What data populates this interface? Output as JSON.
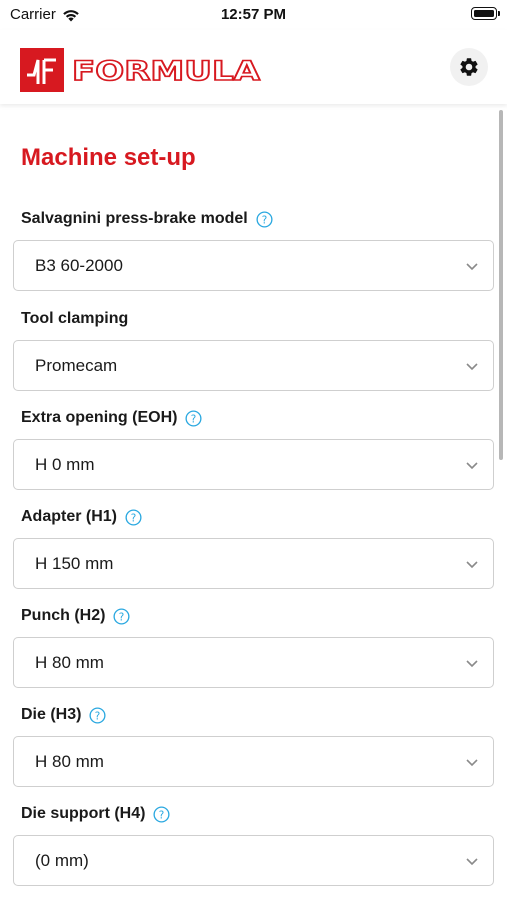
{
  "status_bar": {
    "carrier": "Carrier",
    "time": "12:57 PM"
  },
  "header": {
    "brand": "FORMULA",
    "brand_color": "#d71920",
    "settings_icon": "gear-icon"
  },
  "page": {
    "title": "Machine set-up"
  },
  "fields": [
    {
      "label": "Salvagnini press-brake model",
      "has_help": true,
      "value": "B3 60-2000"
    },
    {
      "label": "Tool clamping",
      "has_help": false,
      "value": "Promecam"
    },
    {
      "label": "Extra opening (EOH)",
      "has_help": true,
      "value": "H 0 mm"
    },
    {
      "label": "Adapter (H1)",
      "has_help": true,
      "value": "H 150 mm"
    },
    {
      "label": "Punch (H2)",
      "has_help": true,
      "value": "H 80 mm"
    },
    {
      "label": "Die (H3)",
      "has_help": true,
      "value": "H 80 mm"
    },
    {
      "label": "Die support (H4)",
      "has_help": true,
      "value": "(0 mm)"
    }
  ],
  "colors": {
    "accent": "#d71920",
    "help_icon": "#2aa8e0",
    "border": "#cfcfcf"
  }
}
